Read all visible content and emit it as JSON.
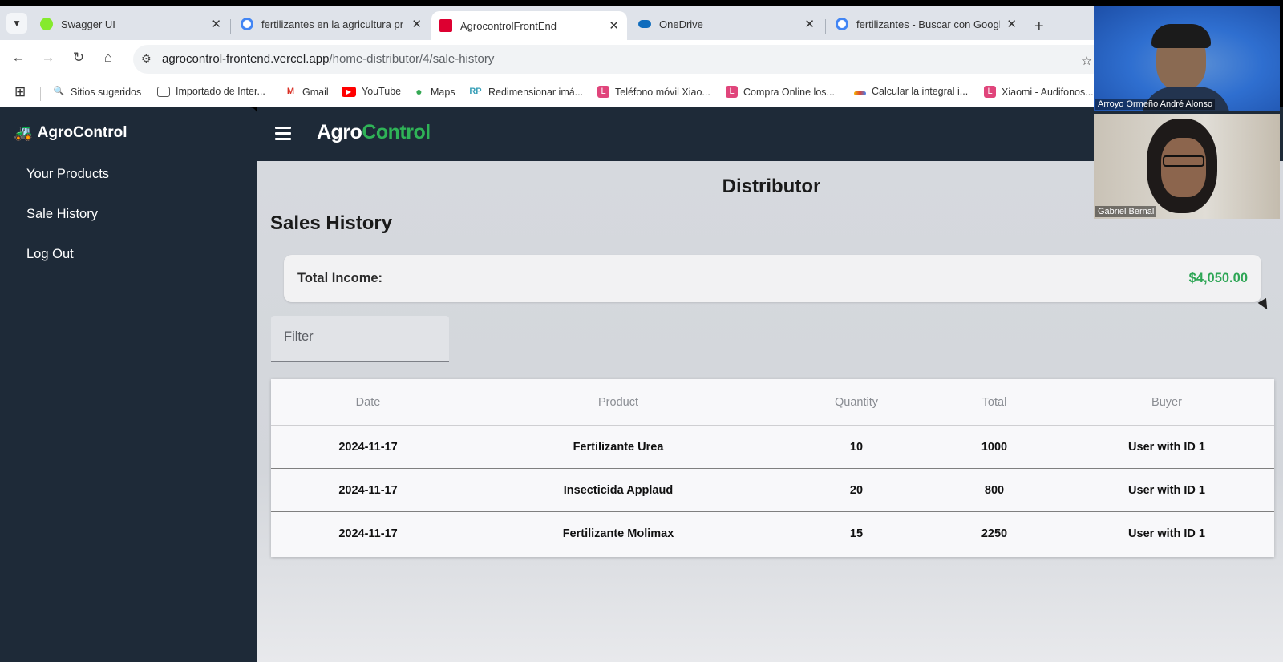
{
  "browser": {
    "tabs": [
      {
        "title": "Swagger UI",
        "favicon": "swagger-icon",
        "color": "#85ea2d",
        "active": false
      },
      {
        "title": "fertilizantes en la agricultura pr",
        "favicon": "google-icon",
        "color": "#4285f4",
        "active": false
      },
      {
        "title": "AgrocontrolFrontEnd",
        "favicon": "angular-icon",
        "color": "#dd0031",
        "active": true
      },
      {
        "title": "OneDrive",
        "favicon": "onedrive-icon",
        "color": "#0f6cbd",
        "active": false
      },
      {
        "title": "fertilizantes - Buscar con Googl",
        "favicon": "google-icon",
        "color": "#4285f4",
        "active": false
      }
    ],
    "url_host": "agrocontrol-frontend.vercel.app",
    "url_path": "/home-distributor/4/sale-history",
    "bookmarks": [
      {
        "label": "Sitios sugeridos",
        "icon": "search-icon"
      },
      {
        "label": "Importado de Inter...",
        "icon": "folder-icon"
      },
      {
        "label": "Gmail",
        "icon": "gmail-icon"
      },
      {
        "label": "YouTube",
        "icon": "youtube-icon"
      },
      {
        "label": "Maps",
        "icon": "maps-icon"
      },
      {
        "label": "Redimensionar imá...",
        "icon": "rp-icon"
      },
      {
        "label": "Teléfono móvil Xiao...",
        "icon": "shop-icon"
      },
      {
        "label": "Compra Online los...",
        "icon": "shop-icon"
      },
      {
        "label": "Calcular la integral i...",
        "icon": "calc-icon"
      },
      {
        "label": "Xiaomi - Audifonos...",
        "icon": "shop-icon"
      }
    ]
  },
  "sidebar": {
    "brand": "AgroControl",
    "items": [
      {
        "label": "Your Products"
      },
      {
        "label": "Sale History"
      },
      {
        "label": "Log Out"
      }
    ]
  },
  "header": {
    "title_part1": "Agro",
    "title_part2": "Control",
    "accent_color": "#2fb357"
  },
  "page": {
    "role_title": "Distributor",
    "section_title": "Sales History",
    "income_label": "Total Income:",
    "income_value": "$4,050.00",
    "filter_placeholder": "Filter"
  },
  "table": {
    "columns": [
      "Date",
      "Product",
      "Quantity",
      "Total",
      "Buyer"
    ],
    "rows": [
      [
        "2024-11-17",
        "Fertilizante Urea",
        "10",
        "1000",
        "User with ID 1"
      ],
      [
        "2024-11-17",
        "Insecticida Applaud",
        "20",
        "800",
        "User with ID 1"
      ],
      [
        "2024-11-17",
        "Fertilizante Molimax",
        "15",
        "2250",
        "User with ID 1"
      ]
    ]
  },
  "participants": [
    {
      "name": "Arroyo Ormeño André Alonso"
    },
    {
      "name": "Gabriel Bernal"
    }
  ]
}
